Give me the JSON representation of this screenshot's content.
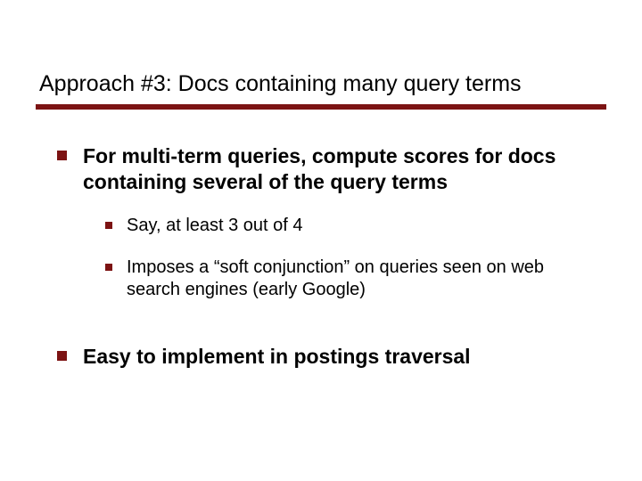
{
  "title": "Approach #3: Docs containing many query terms",
  "points": {
    "p1": "For multi-term queries, compute scores for docs containing several of the query terms",
    "p1a": "Say, at least 3 out of 4",
    "p1b": "Imposes a “soft conjunction” on queries seen on web search engines (early Google)",
    "p2": "Easy to implement in postings traversal"
  },
  "colors": {
    "accent": "#7c1313"
  }
}
